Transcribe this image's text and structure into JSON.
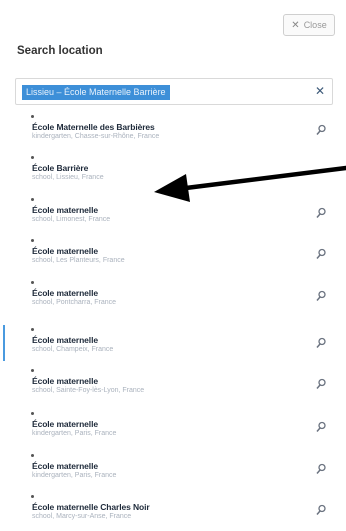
{
  "header": {
    "close_label": "Close",
    "close_icon": "x-icon"
  },
  "title": "Search location",
  "search": {
    "value": "Lissieu – École Maternelle Barrière",
    "clear_icon": "x-icon"
  },
  "results": [
    {
      "name": "École Maternelle des Barbières",
      "detail": "kindergarten, Chasse-sur-Rhône, France",
      "icon": "pin-icon"
    },
    {
      "name": "École Barrière",
      "detail": "school, Lissieu, France",
      "icon": ""
    },
    {
      "name": "École maternelle",
      "detail": "school, Limonest, France",
      "icon": "pin-icon"
    },
    {
      "name": "École maternelle",
      "detail": "school, Les Planteurs, France",
      "icon": "pin-icon"
    },
    {
      "name": "École maternelle",
      "detail": "school, Pontcharra, France",
      "icon": "pin-icon"
    },
    {
      "name": "École maternelle",
      "detail": "school, Champeix, France",
      "icon": "pin-icon"
    },
    {
      "name": "École maternelle",
      "detail": "school, Sainte-Foy-lès-Lyon, France",
      "icon": "pin-icon"
    },
    {
      "name": "École maternelle",
      "detail": "kindergarten, Paris, France",
      "icon": "pin-icon"
    },
    {
      "name": "École maternelle",
      "detail": "kindergarten, Paris, France",
      "icon": "pin-icon"
    },
    {
      "name": "École maternelle Charles Noir",
      "detail": "school, Marcy-sur-Anse, France",
      "icon": "pin-icon"
    }
  ],
  "active_result": 5,
  "annotation": {
    "icon": "arrow-left-icon",
    "color": "#000000"
  },
  "accent_color": "#3d8fd8"
}
